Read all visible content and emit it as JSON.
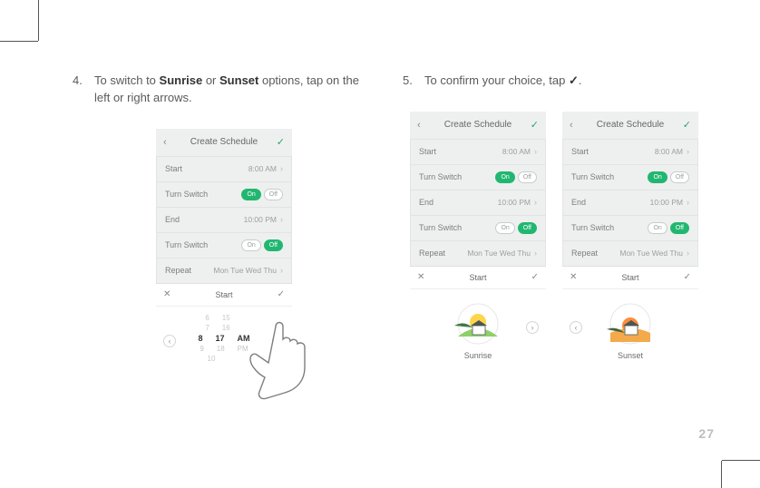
{
  "page_number": "27",
  "step4": {
    "number": "4.",
    "text_before": "To switch to ",
    "bold1": "Sunrise",
    "text_mid": " or ",
    "bold2": "Sunset",
    "text_after": " options, tap on the left or right arrows."
  },
  "step5": {
    "number": "5.",
    "text_before": "To confirm your choice, tap ",
    "icon": "✓",
    "text_after": "."
  },
  "phone_a": {
    "title": "Create Schedule",
    "rows": {
      "start_label": "Start",
      "start_val": "8:00 AM",
      "ts1_label": "Turn Switch",
      "ts1_on": "On",
      "ts1_off": "Off",
      "end_label": "End",
      "end_val": "10:00 PM",
      "ts2_label": "Turn Switch",
      "ts2_on": "On",
      "ts2_off": "Off",
      "repeat_label": "Repeat",
      "repeat_val": "Mon Tue Wed Thu"
    },
    "sheet": {
      "title": "Start",
      "picker": {
        "r1": [
          "6",
          "15",
          ""
        ],
        "r2": [
          "7",
          "16",
          ""
        ],
        "sel": [
          "8",
          "17",
          "AM"
        ],
        "r4": [
          "9",
          "18",
          "PM"
        ],
        "r5": [
          "10",
          "",
          ""
        ]
      }
    }
  },
  "phone_b": {
    "title": "Create Schedule",
    "rows": {
      "start_label": "Start",
      "start_val": "8:00 AM",
      "ts1_label": "Turn Switch",
      "ts1_on": "On",
      "ts1_off": "Off",
      "end_label": "End",
      "end_val": "10:00 PM",
      "ts2_label": "Turn Switch",
      "ts2_on": "On",
      "ts2_off": "Off",
      "repeat_label": "Repeat",
      "repeat_val": "Mon Tue Wed Thu"
    },
    "sheet": {
      "title": "Start",
      "label": "Sunrise"
    }
  },
  "phone_c": {
    "title": "Create Schedule",
    "rows": {
      "start_label": "Start",
      "start_val": "8:00 AM",
      "ts1_label": "Turn Switch",
      "ts1_on": "On",
      "ts1_off": "Off",
      "end_label": "End",
      "end_val": "10:00 PM",
      "ts2_label": "Turn Switch",
      "ts2_on": "On",
      "ts2_off": "Off",
      "repeat_label": "Repeat",
      "repeat_val": "Mon Tue Wed Thu"
    },
    "sheet": {
      "title": "Start",
      "label": "Sunset"
    }
  }
}
